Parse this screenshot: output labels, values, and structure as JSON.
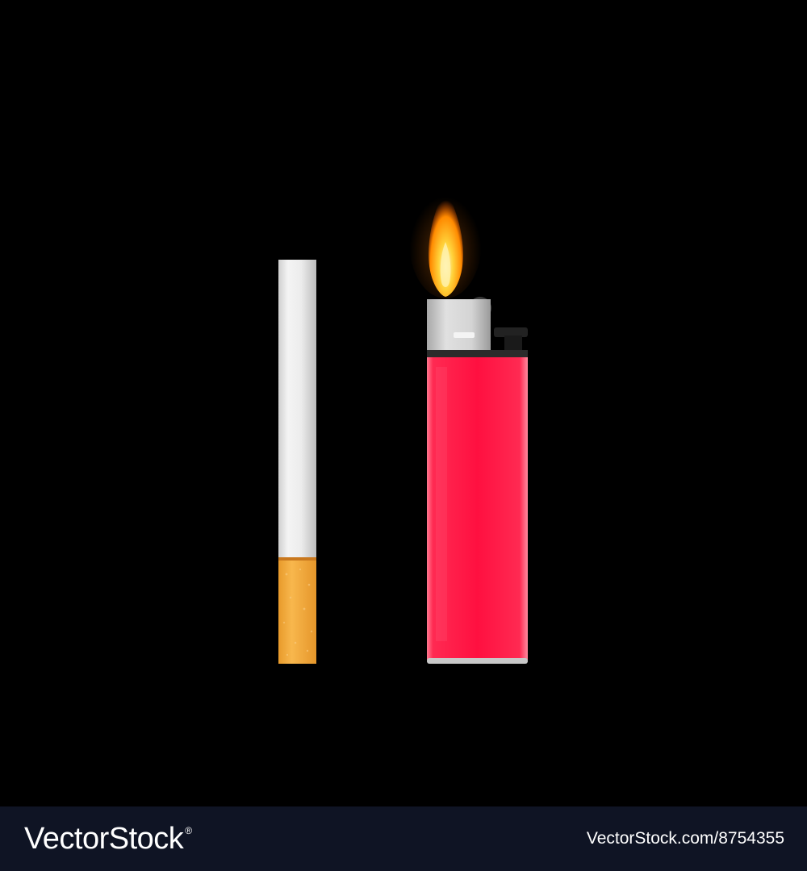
{
  "scene": {
    "background": "#000000",
    "objects": [
      {
        "name": "cigarette",
        "paper_color": "#e9e9e9",
        "filter_color": "#f2a93b"
      },
      {
        "name": "lighter",
        "body_color": "#ff1a45",
        "cap_color": "#c9c9c9",
        "flame_color": "#ffb52e"
      }
    ]
  },
  "footer": {
    "background": "#0f1424",
    "brand": "VectorStock",
    "registered_mark": "®",
    "image_id": "VectorStock.com/8754355"
  }
}
